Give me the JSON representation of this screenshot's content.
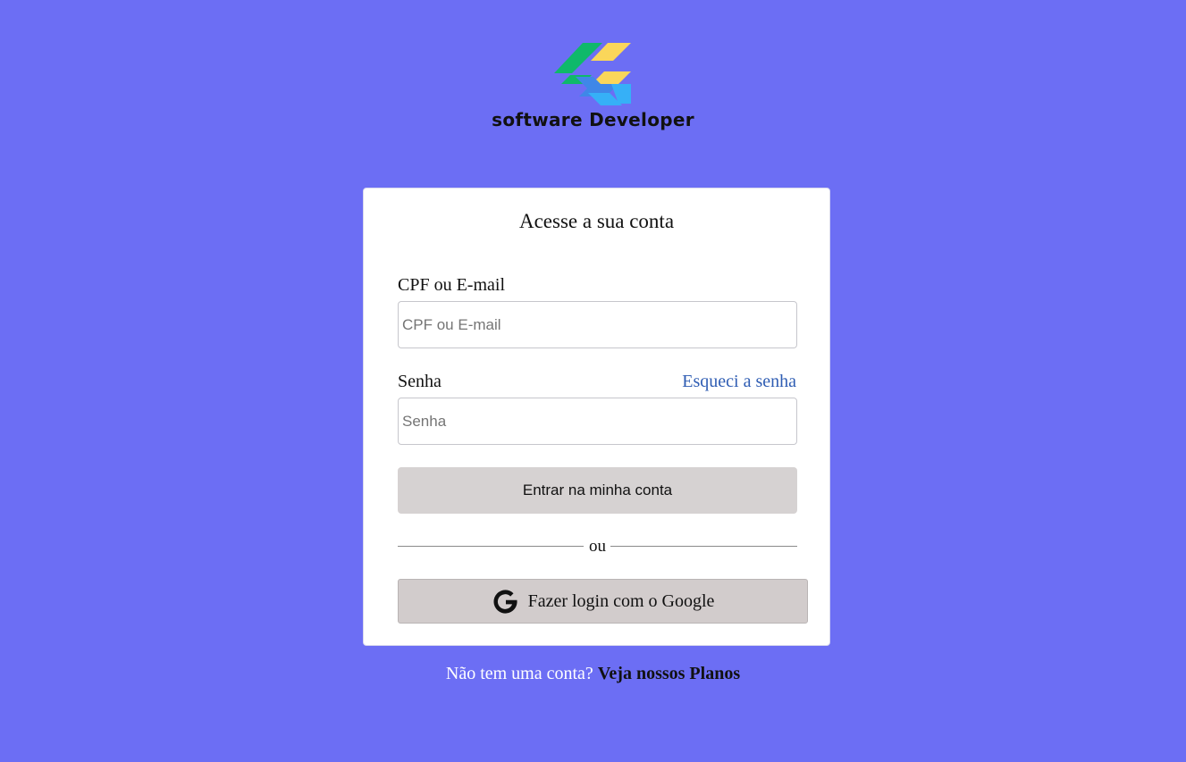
{
  "brand": {
    "logo_icon": "flutter-style-logo-icon",
    "name": "software Developer",
    "logo_colors": [
      "#0fb96a",
      "#fad65a",
      "#36b0f7",
      "#3f87e8"
    ]
  },
  "login_card": {
    "title": "Acesse a sua conta",
    "email_label": "CPF ou E-mail",
    "email_placeholder": "CPF ou E-mail",
    "email_value": "",
    "password_label": "Senha",
    "forgot_password_link": "Esqueci a senha",
    "password_placeholder": "Senha",
    "password_value": "",
    "submit_label": "Entrar na minha conta",
    "divider_text": "ou",
    "google_icon": "google-g-icon",
    "google_label": "Fazer login com o Google"
  },
  "signup": {
    "prompt": "Não tem uma conta?",
    "link": "Veja nossos Planos"
  },
  "colors": {
    "background": "#6c6ef4",
    "card": "#ffffff",
    "link": "#2f5db3",
    "button": "#d6d2d2"
  }
}
